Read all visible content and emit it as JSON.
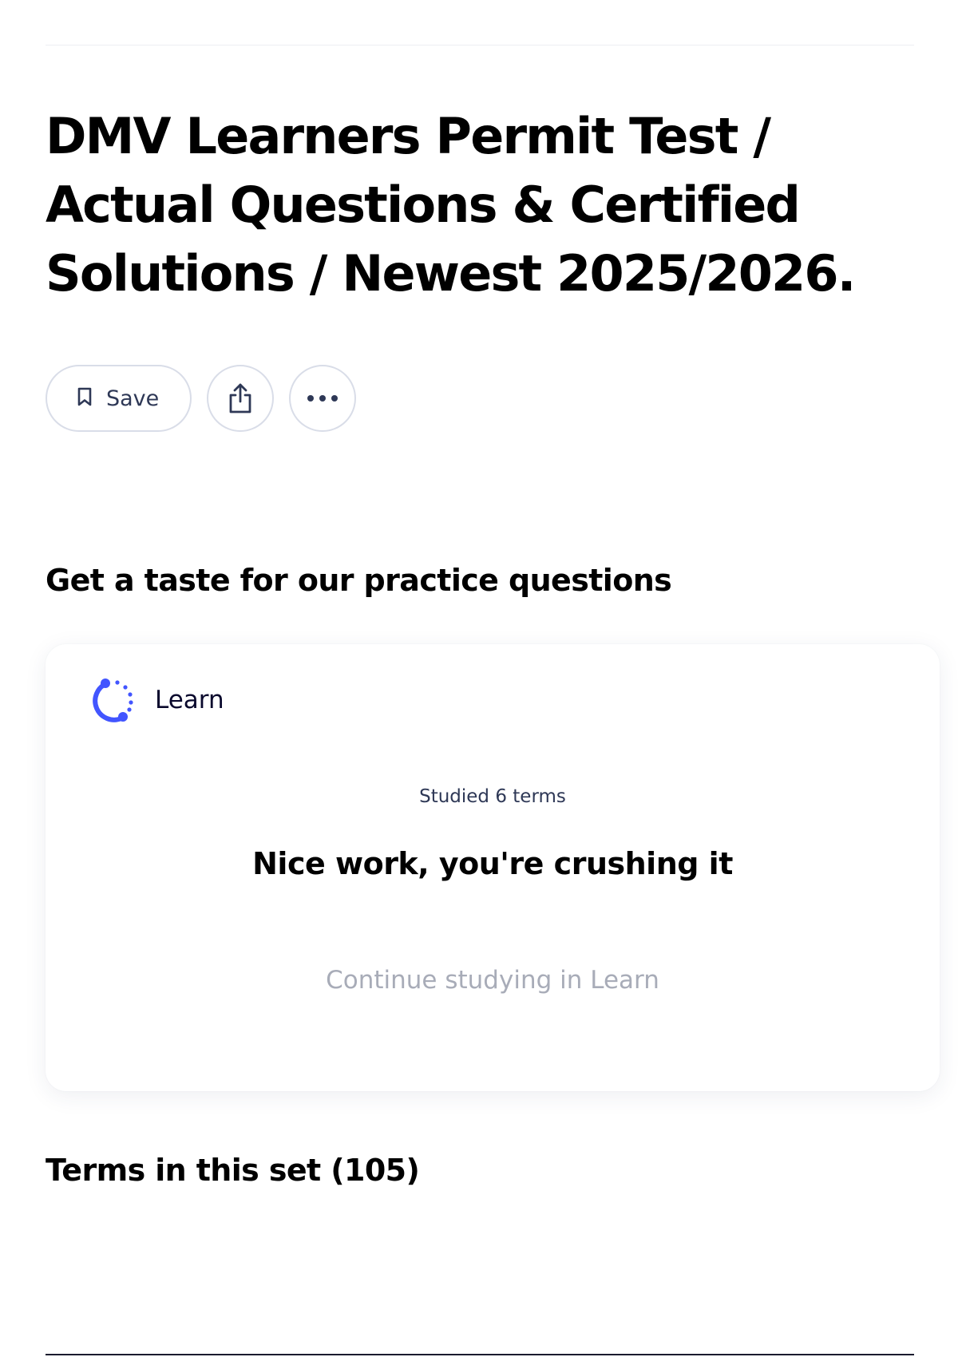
{
  "set": {
    "title": "DMV Learners Permit Test / Actual Questions & Certified Solutions / Newest 2025/2026."
  },
  "actions": {
    "save_label": "Save",
    "share_icon": "share-icon",
    "more_icon": "more-options-icon"
  },
  "practice": {
    "heading": "Get a taste for our practice questions",
    "card": {
      "mode_icon": "learn-icon",
      "mode_label": "Learn",
      "studied": "Studied 6 terms",
      "headline": "Nice work, you're crushing it",
      "continue_label": "Continue studying in Learn"
    }
  },
  "terms": {
    "heading": "Terms in this set (105)"
  },
  "colors": {
    "accent": "#4255ff",
    "text_primary": "#000000",
    "text_muted": "#a8acb8",
    "border": "#d9dde8"
  }
}
